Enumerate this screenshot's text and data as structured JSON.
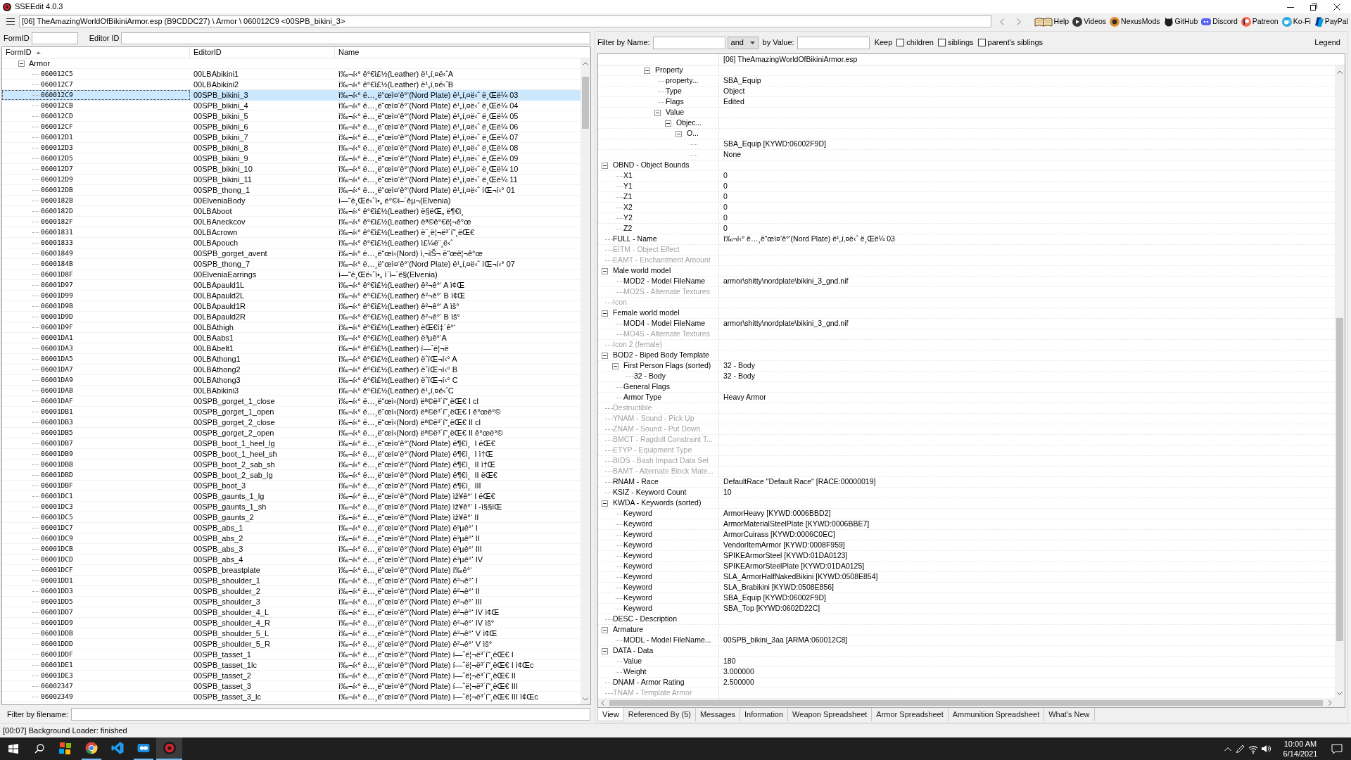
{
  "window": {
    "title": "SSEEdit 4.0.3"
  },
  "navigation": {
    "path": "[06] TheAmazingWorldOfBikiniArmor.esp (B9CDDC27) \\ Armor \\ 060012C9 <00SPB_bikini_3>",
    "history_buttons": [
      {
        "disabled": true
      },
      {
        "disabled": true
      }
    ],
    "links": [
      {
        "label": "Help"
      },
      {
        "label": "Videos"
      },
      {
        "label": "NexusMods"
      },
      {
        "label": "GitHub"
      },
      {
        "label": "Discord"
      },
      {
        "label": "Patreon"
      },
      {
        "label": "Ko-Fi"
      },
      {
        "label": "PayPal"
      }
    ]
  },
  "record_filter": {
    "form_id": {
      "label": "FormID"
    },
    "editor_id": {
      "label": "Editor ID"
    }
  },
  "record_list": {
    "columns": [
      {
        "label": "FormID",
        "sorted": true
      },
      {
        "label": "EditorID",
        "sorted": false
      },
      {
        "label": "Name",
        "sorted": false
      }
    ],
    "groups": [
      {
        "label": "Armor",
        "expanded": true,
        "children": [
          {
            "form_id": "060012C5",
            "editor_id": "00LBAbikini1",
            "name": "ì‰¬í‹° ê°€ì£½(Leather) ë¹„í‚¤ë‹ˆA",
            "selected": false
          },
          {
            "form_id": "060012C7",
            "editor_id": "00LBAbikini2",
            "name": "ì‰¬í‹° ê°€ì£½(Leather) ë¹„í‚¤ë‹ˆB",
            "selected": false
          },
          {
            "form_id": "060012C9",
            "editor_id": "00SPB_bikini_3",
            "name": "ì‰¬í‹° ë…¸ë“œì¤‘ê°‘(Nord Plate) ë¹„í‚¤ë‹ˆ ë¸Œë¼ 03",
            "selected": true
          },
          {
            "form_id": "060012CB",
            "editor_id": "00SPB_bikini_4",
            "name": "ì‰¬í‹° ë…¸ë“œì¤‘ê°‘(Nord Plate) ë¹„í‚¤ë‹ˆ ë¸Œë¼ 04",
            "selected": false
          },
          {
            "form_id": "060012CD",
            "editor_id": "00SPB_bikini_5",
            "name": "ì‰¬í‹° ë…¸ë“œì¤‘ê°‘(Nord Plate) ë¹„í‚¤ë‹ˆ ë¸Œë¼ 05",
            "selected": false
          },
          {
            "form_id": "060012CF",
            "editor_id": "00SPB_bikini_6",
            "name": "ì‰¬í‹° ë…¸ë“œì¤‘ê°‘(Nord Plate) ë¹„í‚¤ë‹ˆ ë¸Œë¼ 06",
            "selected": false
          },
          {
            "form_id": "060012D1",
            "editor_id": "00SPB_bikini_7",
            "name": "ì‰¬í‹° ë…¸ë“œì¤‘ê°‘(Nord Plate) ë¹„í‚¤ë‹ˆ ë¸Œë¼ 07",
            "selected": false
          },
          {
            "form_id": "060012D3",
            "editor_id": "00SPB_bikini_8",
            "name": "ì‰¬í‹° ë…¸ë“œì¤‘ê°‘(Nord Plate) ë¹„í‚¤ë‹ˆ ë¸Œë¼ 08",
            "selected": false
          },
          {
            "form_id": "060012D5",
            "editor_id": "00SPB_bikini_9",
            "name": "ì‰¬í‹° ë…¸ë“œì¤‘ê°‘(Nord Plate) ë¹„í‚¤ë‹ˆ ë¸Œë¼ 09",
            "selected": false
          },
          {
            "form_id": "060012D7",
            "editor_id": "00SPB_bikini_10",
            "name": "ì‰¬í‹° ë…¸ë“œì¤‘ê°‘(Nord Plate) ë¹„í‚¤ë‹ˆ ë¸Œë¼ 10",
            "selected": false
          },
          {
            "form_id": "060012D9",
            "editor_id": "00SPB_bikini_11",
            "name": "ì‰¬í‹° ë…¸ë“œì¤‘ê°‘(Nord Plate) ë¹„í‚¤ë‹ˆ ë¸Œë¼ 11",
            "selected": false
          },
          {
            "form_id": "060012DB",
            "editor_id": "00SPB_thong_1",
            "name": "ì‰¬í‹° ë…¸ë“œì¤‘ê°‘(Nord Plate) ë¹„í‚¤ë‹ˆ íŒ¬í‹° 01",
            "selected": false
          },
          {
            "form_id": "0600182B",
            "editor_id": "00ElveniaBody",
            "name": "ì—˜ë¸Œë‹ˆì•„ ë°©ì–´êµ¬(Elvenia)",
            "selected": false
          },
          {
            "form_id": "0600182D",
            "editor_id": "00LBAboot",
            "name": "ì‰¬í‹° ê°€ì£½(Leather) ë§ëŒ„ ë¶€ì¸",
            "selected": false
          },
          {
            "form_id": "0600182F",
            "editor_id": "00LBAneckcov",
            "name": "ì‰¬í‹° ê°€ì£½(Leather) ëª©ê°€ë¦¬ê°œ",
            "selected": false
          },
          {
            "form_id": "06001831",
            "editor_id": "00LBAcrown",
            "name": "ì‰¬í‹° ê°€ì£½(Leather) ë¨¸ë¦¬ë³´í˜¸ëŒ€",
            "selected": false
          },
          {
            "form_id": "06001833",
            "editor_id": "00LBApouch",
            "name": "ì‰¬í‹° ê°€ì£½(Leather) ì£¼ë¨¸ë‹ˆ",
            "selected": false
          },
          {
            "form_id": "06001849",
            "editor_id": "00SPB_gorget_avent",
            "name": "ì‰¬í‹° ë…¸ë“œì‹(Nord) ì‚¬ìŠ¬ ë“œë¦¬ê°œ",
            "selected": false
          },
          {
            "form_id": "0600184B",
            "editor_id": "00SPB_thong_7",
            "name": "ì‰¬í‹° ë…¸ë“œì¤‘ê°‘(Nord Plate) ë¹„í‚¤ë‹ˆ íŒ¬í‹° 07",
            "selected": false
          },
          {
            "form_id": "06001D8F",
            "editor_id": "00ElveniaEarrings",
            "name": "ì—˜ë¸Œë‹ˆì•„ ì´ì–´ë§(Elvenia)",
            "selected": false
          },
          {
            "form_id": "06001D97",
            "editor_id": "00LBApauld1L",
            "name": "ì‰¬í‹° ê°€ì£½(Leather) ê²¬ê°‘ A ì¢Œ",
            "selected": false
          },
          {
            "form_id": "06001D99",
            "editor_id": "00LBApauld2L",
            "name": "ì‰¬í‹° ê°€ì£½(Leather) ê²¬ê°‘ B ì¢Œ",
            "selected": false
          },
          {
            "form_id": "06001D9B",
            "editor_id": "00LBApauld1R",
            "name": "ì‰¬í‹° ê°€ì£½(Leather) ê²¬ê°‘ A ìš°",
            "selected": false
          },
          {
            "form_id": "06001D9D",
            "editor_id": "00LBApauld2R",
            "name": "ì‰¬í‹° ê°€ì£½(Leather) ê²¬ê°‘ B ìš°",
            "selected": false
          },
          {
            "form_id": "06001D9F",
            "editor_id": "00LBAthigh",
            "name": "ì‰¬í‹° ê°€ì£½(Leather) ëŒ€í‡´ê°‘",
            "selected": false
          },
          {
            "form_id": "06001DA1",
            "editor_id": "00LBAabs1",
            "name": "ì‰¬í‹° ê°€ì£½(Leather) ë³µê°‘A",
            "selected": false
          },
          {
            "form_id": "06001DA3",
            "editor_id": "00LBAbelt1",
            "name": "ì‰¬í‹° ê°€ì£½(Leather) í—ˆë¦¬ë",
            "selected": false
          },
          {
            "form_id": "06001DA5",
            "editor_id": "00LBAthong1",
            "name": "ì‰¬í‹° ê°€ì£½(Leather) ëˆíŒ¬í‹° A",
            "selected": false
          },
          {
            "form_id": "06001DA7",
            "editor_id": "00LBAthong2",
            "name": "ì‰¬í‹° ê°€ì£½(Leather) ëˆíŒ¬í‹° B",
            "selected": false
          },
          {
            "form_id": "06001DA9",
            "editor_id": "00LBAthong3",
            "name": "ì‰¬í‹° ê°€ì£½(Leather) ëˆíŒ¬í‹° C",
            "selected": false
          },
          {
            "form_id": "06001DAB",
            "editor_id": "00LBAbikini3",
            "name": "ì‰¬í‹° ê°€ì£½(Leather) ë¹„í‚¤ë‹ˆC",
            "selected": false
          },
          {
            "form_id": "06001DAF",
            "editor_id": "00SPB_gorget_1_close",
            "name": "ì‰¬í‹° ë…¸ë“œì‹(Nord) ëª©ë³´í˜¸ëŒ€ I cl",
            "selected": false
          },
          {
            "form_id": "06001DB1",
            "editor_id": "00SPB_gorget_1_open",
            "name": "ì‰¬í‹° ë…¸ë“œì‹(Nord) ëª©ë³´í˜¸ëŒ€ I ê°œë°©",
            "selected": false
          },
          {
            "form_id": "06001DB3",
            "editor_id": "00SPB_gorget_2_close",
            "name": "ì‰¬í‹° ë…¸ë“œì‹(Nord) ëª©ë³´í˜¸ëŒ€ II cl",
            "selected": false
          },
          {
            "form_id": "06001DB5",
            "editor_id": "00SPB_gorget_2_open",
            "name": "ì‰¬í‹° ë…¸ë“œì‹(Nord) ëª©ë³´í˜¸ëŒ€ II ê°œë°©",
            "selected": false
          },
          {
            "form_id": "06001DB7",
            "editor_id": "00SPB_boot_1_heel_lg",
            "name": "ì‰¬í‹° ë…¸ë“œì¤‘ê°‘(Nord Plate) ë¶€ì¸  I ëŒ€",
            "selected": false
          },
          {
            "form_id": "06001DB9",
            "editor_id": "00SPB_boot_1_heel_sh",
            "name": "ì‰¬í‹° ë…¸ë“œì¤‘ê°‘(Nord Plate) ë¶€ì¸  I ì†Œ",
            "selected": false
          },
          {
            "form_id": "06001DBB",
            "editor_id": "00SPB_boot_2_sab_sh",
            "name": "ì‰¬í‹° ë…¸ë“œì¤‘ê°‘(Nord Plate) ë¶€ì¸  II ì†Œ",
            "selected": false
          },
          {
            "form_id": "06001DBD",
            "editor_id": "00SPB_boot_2_sab_lg",
            "name": "ì‰¬í‹° ë…¸ë“œì¤‘ê°‘(Nord Plate) ë¶€ì¸  II ëŒ€",
            "selected": false
          },
          {
            "form_id": "06001DBF",
            "editor_id": "00SPB_boot_3",
            "name": "ì‰¬í‹° ë…¸ë“œì¤‘ê°‘(Nord Plate) ë¶€ì¸  III",
            "selected": false
          },
          {
            "form_id": "06001DC1",
            "editor_id": "00SPB_gaunts_1_lg",
            "name": "ì‰¬í‹° ë…¸ë“œì¤‘ê°‘(Nord Plate) ìž¥ê°‘ I ëŒ€",
            "selected": false
          },
          {
            "form_id": "06001DC3",
            "editor_id": "00SPB_gaunts_1_sh",
            "name": "ì‰¬í‹° ë…¸ë“œì¤‘ê°‘(Nord Plate) ìž¥ê°‘ I -ì§§ìŒ",
            "selected": false
          },
          {
            "form_id": "06001DC5",
            "editor_id": "00SPB_gaunts_2",
            "name": "ì‰¬í‹° ë…¸ë“œì¤‘ê°‘(Nord Plate) ìž¥ê°‘ II",
            "selected": false
          },
          {
            "form_id": "06001DC7",
            "editor_id": "00SPB_abs_1",
            "name": "ì‰¬í‹° ë…¸ë“œì¤‘ê°‘(Nord Plate) ë³µê°‘ I",
            "selected": false
          },
          {
            "form_id": "06001DC9",
            "editor_id": "00SPB_abs_2",
            "name": "ì‰¬í‹° ë…¸ë“œì¤‘ê°‘(Nord Plate) ë³µê°‘ II",
            "selected": false
          },
          {
            "form_id": "06001DCB",
            "editor_id": "00SPB_abs_3",
            "name": "ì‰¬í‹° ë…¸ë“œì¤‘ê°‘(Nord Plate) ë³µê°‘ III",
            "selected": false
          },
          {
            "form_id": "06001DCD",
            "editor_id": "00SPB_abs_4",
            "name": "ì‰¬í‹° ë…¸ë“œì¤‘ê°‘(Nord Plate) ë³µê°‘ IV",
            "selected": false
          },
          {
            "form_id": "06001DCF",
            "editor_id": "00SPB_breastplate",
            "name": "ì‰¬í‹° ë…¸ë“œì¤‘ê°‘(Nord Plate) í‰ê°‘",
            "selected": false
          },
          {
            "form_id": "06001DD1",
            "editor_id": "00SPB_shoulder_1",
            "name": "ì‰¬í‹° ë…¸ë“œì¤‘ê°‘(Nord Plate) ê²¬ê°‘ I",
            "selected": false
          },
          {
            "form_id": "06001DD3",
            "editor_id": "00SPB_shoulder_2",
            "name": "ì‰¬í‹° ë…¸ë“œì¤‘ê°‘(Nord Plate) ê²¬ê°‘ II",
            "selected": false
          },
          {
            "form_id": "06001DD5",
            "editor_id": "00SPB_shoulder_3",
            "name": "ì‰¬í‹° ë…¸ë“œì¤‘ê°‘(Nord Plate) ê²¬ê°‘ III",
            "selected": false
          },
          {
            "form_id": "06001DD7",
            "editor_id": "00SPB_shoulder_4_L",
            "name": "ì‰¬í‹° ë…¸ë“œì¤‘ê°‘(Nord Plate) ê²¬ê°‘ IV ì¢Œ",
            "selected": false
          },
          {
            "form_id": "06001DD9",
            "editor_id": "00SPB_shoulder_4_R",
            "name": "ì‰¬í‹° ë…¸ë“œì¤‘ê°‘(Nord Plate) ê²¬ê°‘ IV ìš°",
            "selected": false
          },
          {
            "form_id": "06001DDB",
            "editor_id": "00SPB_shoulder_5_L",
            "name": "ì‰¬í‹° ë…¸ë“œì¤‘ê°‘(Nord Plate) ê²¬ê°‘ V ì¢Œ",
            "selected": false
          },
          {
            "form_id": "06001DDD",
            "editor_id": "00SPB_shoulder_5_R",
            "name": "ì‰¬í‹° ë…¸ë“œì¤‘ê°‘(Nord Plate) ê²¬ê°‘ V ìš°",
            "selected": false
          },
          {
            "form_id": "06001DDF",
            "editor_id": "00SPB_tasset_1",
            "name": "ì‰¬í‹° ë…¸ë“œì¤‘ê°‘(Nord Plate) í—ˆë¦¬ë³´í˜¸ëŒ€ I",
            "selected": false
          },
          {
            "form_id": "06001DE1",
            "editor_id": "00SPB_tasset_1lc",
            "name": "ì‰¬í‹° ë…¸ë“œì¤‘ê°‘(Nord Plate) í—ˆë¦¬ë³´í˜¸ëŒ€ I ì¢Œc",
            "selected": false
          },
          {
            "form_id": "06001DE3",
            "editor_id": "00SPB_tasset_2",
            "name": "ì‰¬í‹° ë…¸ë“œì¤‘ê°‘(Nord Plate) í—ˆë¦¬ë³´í˜¸ëŒ€ II",
            "selected": false
          },
          {
            "form_id": "06002347",
            "editor_id": "00SPB_tasset_3",
            "name": "ì‰¬í‹° ë…¸ë“œì¤‘ê°‘(Nord Plate) í—ˆë¦¬ë³´í˜¸ëŒ€ III",
            "selected": false
          },
          {
            "form_id": "06002349",
            "editor_id": "00SPB_tasset_3_lc",
            "name": "ì‰¬í‹° ë…¸ë“œì¤‘ê°‘(Nord Plate) í—ˆë¦¬ë³´í˜¸ëŒ€ III ì¢Œc",
            "selected": false
          }
        ]
      }
    ]
  },
  "filename_filter": {
    "label": "Filter by filename:"
  },
  "view_filter": {
    "name_label": "Filter by Name:",
    "operator": "and",
    "value_label": "by Value:",
    "keep_label": "Keep",
    "keep_options": [
      {
        "label": "children",
        "checked": false
      },
      {
        "label": "siblings",
        "checked": false
      },
      {
        "label": "parent's siblings",
        "checked": false
      }
    ],
    "legend": "Legend"
  },
  "record_view": {
    "header": "[06] TheAmazingWorldOfBikiniArmor.esp",
    "scrolled_nodes": [
      {
        "label": "Property",
        "disabled": false,
        "expanded": true,
        "children": [
          {
            "label": "property...",
            "value": "SBA_Equip",
            "disabled": false
          },
          {
            "label": "Type",
            "value": "Object",
            "disabled": false
          },
          {
            "label": "Flags",
            "value": "Edited",
            "disabled": false
          },
          {
            "label": "Value",
            "disabled": false,
            "expanded": true,
            "children": [
              {
                "label": "Objec...",
                "disabled": false,
                "expanded": true,
                "children": [
                  {
                    "label": "O...",
                    "disabled": false,
                    "expanded": true,
                    "children": [
                      {
                        "value": "SBA_Equip [KYWD:06002F9D]",
                        "disabled": false
                      },
                      {
                        "value": "None",
                        "disabled": false
                      }
                    ]
                  }
                ]
              }
            ]
          }
        ]
      }
    ],
    "nodes": [
      {
        "label": "OBND - Object Bounds",
        "disabled": false,
        "expanded": true,
        "children": [
          {
            "label": "X1",
            "value": "0",
            "disabled": false
          },
          {
            "label": "Y1",
            "value": "0",
            "disabled": false
          },
          {
            "label": "Z1",
            "value": "0",
            "disabled": false
          },
          {
            "label": "X2",
            "value": "0",
            "disabled": false
          },
          {
            "label": "Y2",
            "value": "0",
            "disabled": false
          },
          {
            "label": "Z2",
            "value": "0",
            "disabled": false
          }
        ]
      },
      {
        "label": "FULL - Name",
        "value": "ì‰¬í‹° ë…¸ë“œì¤‘ê°‘(Nord Plate) ë¹„í‚¤ë‹ˆ ë¸Œë¼ 03",
        "disabled": false
      },
      {
        "label": "EITM - Object Effect",
        "disabled": true
      },
      {
        "label": "EAMT - Enchantment Amount",
        "disabled": true
      },
      {
        "label": "Male world model",
        "disabled": false,
        "expanded": true,
        "children": [
          {
            "label": "MOD2 - Model FileName",
            "value": "armor\\shitty\\nordplate\\bikini_3_gnd.nif",
            "disabled": false
          },
          {
            "label": "MO2S - Alternate Textures",
            "disabled": true
          }
        ]
      },
      {
        "label": "Icon",
        "disabled": true
      },
      {
        "label": "Female world model",
        "disabled": false,
        "expanded": true,
        "children": [
          {
            "label": "MOD4 - Model FileName",
            "value": "armor\\shitty\\nordplate\\bikini_3_gnd.nif",
            "disabled": false
          },
          {
            "label": "MO4S - Alternate Textures",
            "disabled": true
          }
        ]
      },
      {
        "label": "Icon 2 (female)",
        "disabled": true
      },
      {
        "label": "BOD2 - Biped Body Template",
        "disabled": false,
        "expanded": true,
        "children": [
          {
            "label": "First Person Flags (sorted)",
            "value": "32 - Body",
            "disabled": false,
            "expanded": true,
            "children": [
              {
                "label": "32 - Body",
                "value": "32 - Body",
                "disabled": false
              }
            ]
          },
          {
            "label": "General Flags",
            "disabled": false
          },
          {
            "label": "Armor Type",
            "value": "Heavy Armor",
            "disabled": false
          }
        ]
      },
      {
        "label": "Destructible",
        "disabled": true
      },
      {
        "label": "YNAM - Sound - Pick Up",
        "disabled": true
      },
      {
        "label": "ZNAM - Sound - Put Down",
        "disabled": true
      },
      {
        "label": "BMCT - Ragdoll Constraint T...",
        "disabled": true
      },
      {
        "label": "ETYP - Equipment Type",
        "disabled": true
      },
      {
        "label": "BIDS - Bash Impact Data Set",
        "disabled": true
      },
      {
        "label": "BAMT - Alternate Block Mate...",
        "disabled": true
      },
      {
        "label": "RNAM - Race",
        "value": "DefaultRace \"Default Race\" [RACE:00000019]",
        "disabled": false
      },
      {
        "label": "KSIZ - Keyword Count",
        "value": "10",
        "disabled": false
      },
      {
        "label": "KWDA - Keywords (sorted)",
        "disabled": false,
        "expanded": true,
        "children": [
          {
            "label": "Keyword",
            "value": "ArmorHeavy [KYWD:0006BBD2]",
            "disabled": false
          },
          {
            "label": "Keyword",
            "value": "ArmorMaterialSteelPlate [KYWD:0006BBE7]",
            "disabled": false
          },
          {
            "label": "Keyword",
            "value": "ArmorCuirass [KYWD:0006C0EC]",
            "disabled": false
          },
          {
            "label": "Keyword",
            "value": "VendorItemArmor [KYWD:0008F959]",
            "disabled": false
          },
          {
            "label": "Keyword",
            "value": "SPIKEArmorSteel [KYWD:01DA0123]",
            "disabled": false
          },
          {
            "label": "Keyword",
            "value": "SPIKEArmorSteelPlate [KYWD:01DA0125]",
            "disabled": false
          },
          {
            "label": "Keyword",
            "value": "SLA_ArmorHalfNakedBikini [KYWD:0508E854]",
            "disabled": false
          },
          {
            "label": "Keyword",
            "value": "SLA_Brabikini [KYWD:0508E856]",
            "disabled": false
          },
          {
            "label": "Keyword",
            "value": "SBA_Equip [KYWD:06002F9D]",
            "disabled": false
          },
          {
            "label": "Keyword",
            "value": "SBA_Top [KYWD:0602D22C]",
            "disabled": false
          }
        ]
      },
      {
        "label": "DESC - Description",
        "disabled": false
      },
      {
        "label": "Armature",
        "disabled": false,
        "expanded": true,
        "children": [
          {
            "label": "MODL - Model FileName...",
            "value": "00SPB_bikini_3aa [ARMA:060012C8]",
            "disabled": false
          }
        ]
      },
      {
        "label": "DATA - Data",
        "disabled": false,
        "expanded": true,
        "children": [
          {
            "label": "Value",
            "value": "180",
            "disabled": false
          },
          {
            "label": "Weight",
            "value": "3.000000",
            "disabled": false
          }
        ]
      },
      {
        "label": "DNAM - Armor Rating",
        "value": "2.500000",
        "disabled": false
      },
      {
        "label": "TNAM - Template Armor",
        "disabled": true
      }
    ]
  },
  "view_tabs": [
    {
      "label": "View",
      "selected": true
    },
    {
      "label": "Referenced By (5)",
      "selected": false
    },
    {
      "label": "Messages",
      "selected": false
    },
    {
      "label": "Information",
      "selected": false
    },
    {
      "label": "Weapon Spreadsheet",
      "selected": false
    },
    {
      "label": "Armor Spreadsheet",
      "selected": false
    },
    {
      "label": "Ammunition Spreadsheet",
      "selected": false
    },
    {
      "label": "What's New",
      "selected": false
    }
  ],
  "status_bar": {
    "text": "[00:07] Background Loader: finished"
  },
  "taskbar": {
    "buttons": [
      {
        "running": false,
        "selected": false
      },
      {
        "running": true,
        "selected": false
      },
      {
        "running": false,
        "selected": false
      },
      {
        "running": true,
        "selected": false
      },
      {
        "running": true,
        "selected": true
      }
    ],
    "time": "10:00 AM",
    "date": "6/14/2021"
  }
}
